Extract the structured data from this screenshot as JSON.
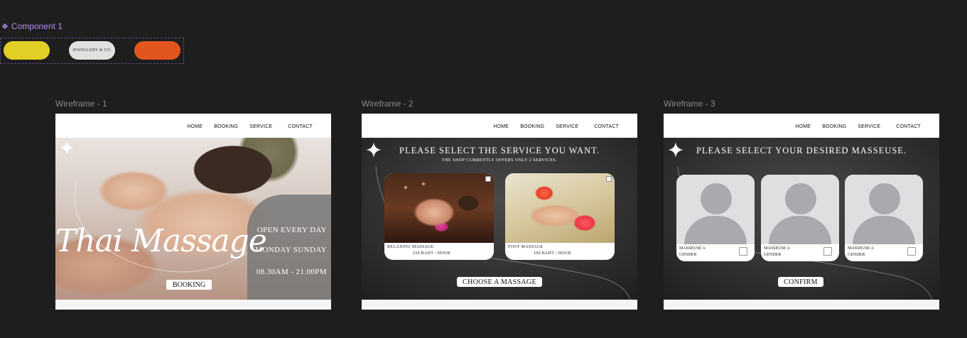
{
  "component": {
    "label": "Component 1",
    "pill_text": "JEWELLERY & CO.",
    "colors": {
      "yellow": "#e2cf25",
      "grey": "#e1e1e1",
      "orange": "#e2561e",
      "accent": "#b48cf0"
    }
  },
  "frames": [
    {
      "title": "Wireframe - 1"
    },
    {
      "title": "Wireframe - 2"
    },
    {
      "title": "Wireframe - 3"
    }
  ],
  "nav": {
    "items": [
      "HOME",
      "BOOKING",
      "SERVICE",
      "CONTACT"
    ]
  },
  "wireframe1": {
    "hero_title": "Thai Massage",
    "line1": "OPEN EVERY DAY",
    "line2": "MONDAY SUNDAY",
    "line3": "08.30AM - 21.00PM",
    "button": "BOOKING"
  },
  "wireframe2": {
    "heading": "PLEASE SELECT THE SERVICE YOU WANT.",
    "subheading": "THE SHOP CURRENTLY OFFERS ONLY 2 SERVICES.",
    "services": [
      {
        "name": "RELAXING MASSAGE",
        "price": "150 BAHT / HOUR"
      },
      {
        "name": "FOOT MASSAGE",
        "price": "100 BAHT / HOUR"
      }
    ],
    "button": "CHOOSE A MASSAGE"
  },
  "wireframe3": {
    "heading": "PLEASE SELECT YOUR DESIRED MASSEUSE.",
    "masseuses": [
      {
        "name": "MASSEUSE A",
        "gender": "GENDER"
      },
      {
        "name": "MASSEUSE A",
        "gender": "GENDER"
      },
      {
        "name": "MASSEUSE A",
        "gender": "GENDER"
      }
    ],
    "button": "CONFIRM"
  },
  "icons": {
    "component": "component-diamond-icon",
    "sparkle": "sparkle-icon",
    "avatar": "user-avatar-icon",
    "checkbox": "checkbox-icon"
  }
}
